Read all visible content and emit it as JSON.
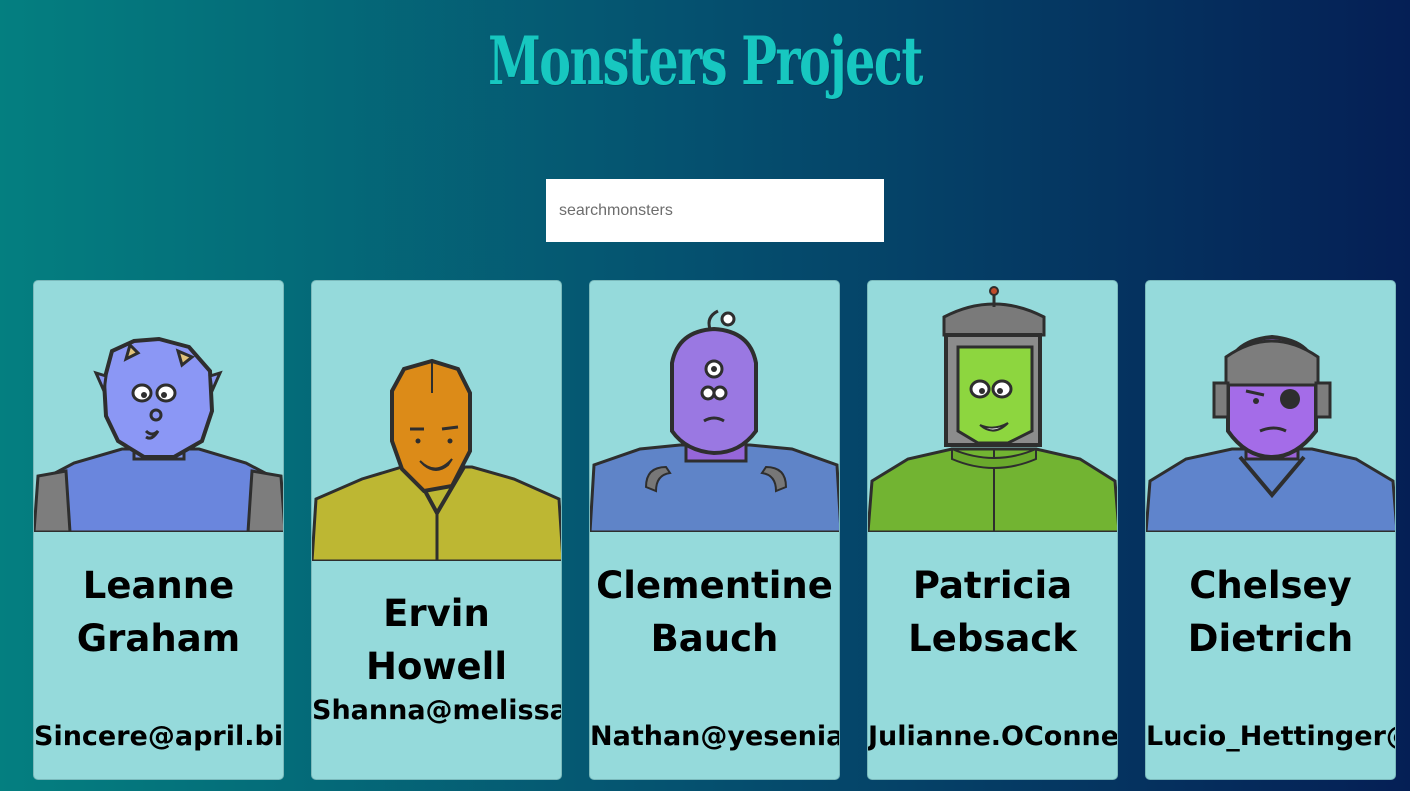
{
  "header": {
    "title": "Monsters Project"
  },
  "search": {
    "placeholder": "searchmonsters",
    "value": ""
  },
  "colors": {
    "title": "#17c7c0",
    "card_background": "#95dadb",
    "gradient_start": "#047f80",
    "gradient_end": "#051f55"
  },
  "monsters": [
    {
      "name": "Leanne Graham",
      "email": "Sincere@april.biz",
      "portrait": "blue-horned-monster-icon"
    },
    {
      "name": "Ervin Howell",
      "email": "Shanna@melissa.tv",
      "portrait": "orange-hooded-monster-icon"
    },
    {
      "name": "Clementine Bauch",
      "email": "Nathan@yesenia.net",
      "portrait": "purple-cyclops-robot-icon"
    },
    {
      "name": "Patricia Lebsack",
      "email": "Julianne.OConner@kory.org",
      "portrait": "green-frankenstein-robot-icon"
    },
    {
      "name": "Chelsey Dietrich",
      "email": "Lucio_Hettinger@annie.ca",
      "portrait": "purple-helmet-cyborg-icon"
    }
  ]
}
